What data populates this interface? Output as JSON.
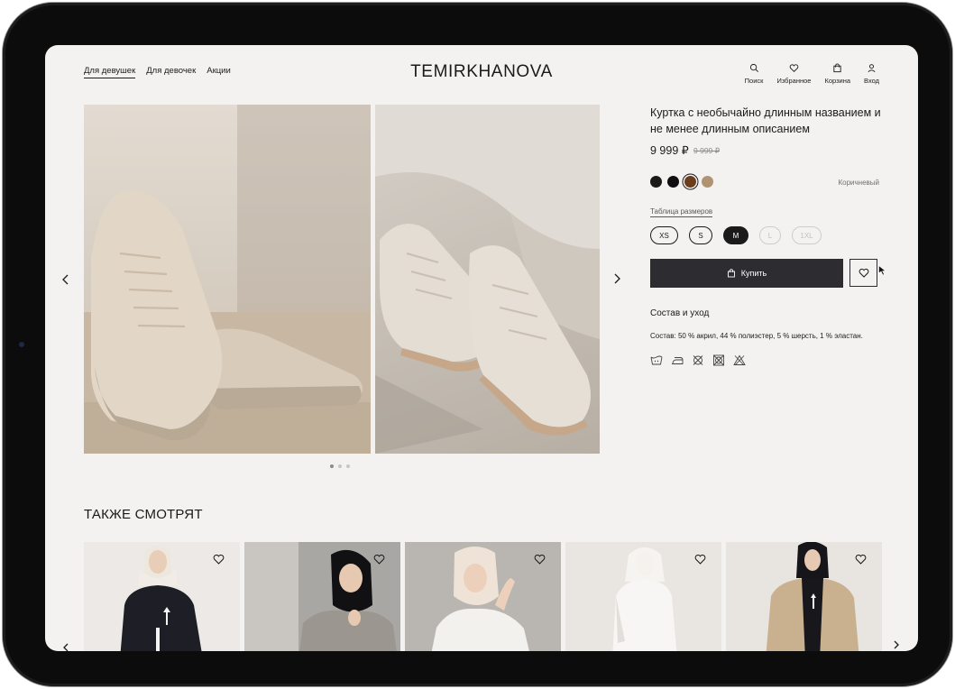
{
  "header": {
    "nav": [
      "Для девушек",
      "Для девочек",
      "Акции"
    ],
    "logo": "TEMIRKHANOVA",
    "actions": [
      "Поиск",
      "Избранное",
      "Корзина",
      "Вход"
    ]
  },
  "gallery": {
    "dots": 3,
    "active_dot": 1
  },
  "product": {
    "title": "Куртка с необычайно длинным названием и не менее длинным описанием",
    "price": "9 999 ₽",
    "old_price": "9 999 ₽",
    "colors": [
      "#1a1a1a",
      "#0f0f12",
      "#6b3d1c",
      "#b09373"
    ],
    "selected_color_index": 2,
    "color_name": "Коричневый",
    "size_chart_link": "Таблица размеров",
    "sizes": [
      {
        "label": "XS",
        "state": "available"
      },
      {
        "label": "S",
        "state": "available"
      },
      {
        "label": "M",
        "state": "selected"
      },
      {
        "label": "L",
        "state": "disabled"
      },
      {
        "label": "1XL",
        "state": "disabled"
      }
    ],
    "buy_label": "Купить",
    "care_title": "Состав и уход",
    "composition": "Состав: 50 % акрил, 44 % полиэстер, 5 % шерсть, 1 % эластан.",
    "care_icons": [
      "wash-30-icon",
      "iron-icon",
      "no-dryclean-icon",
      "no-tumble-dry-icon",
      "no-bleach-icon"
    ]
  },
  "also_viewed": {
    "title": "ТАКЖЕ СМОТРЯТ",
    "cards": [
      {
        "name": "model-black-sweatshirt"
      },
      {
        "name": "model-grey-knit"
      },
      {
        "name": "model-white-sweater"
      },
      {
        "name": "model-white-hoodie"
      },
      {
        "name": "model-beige-jacket"
      }
    ]
  }
}
